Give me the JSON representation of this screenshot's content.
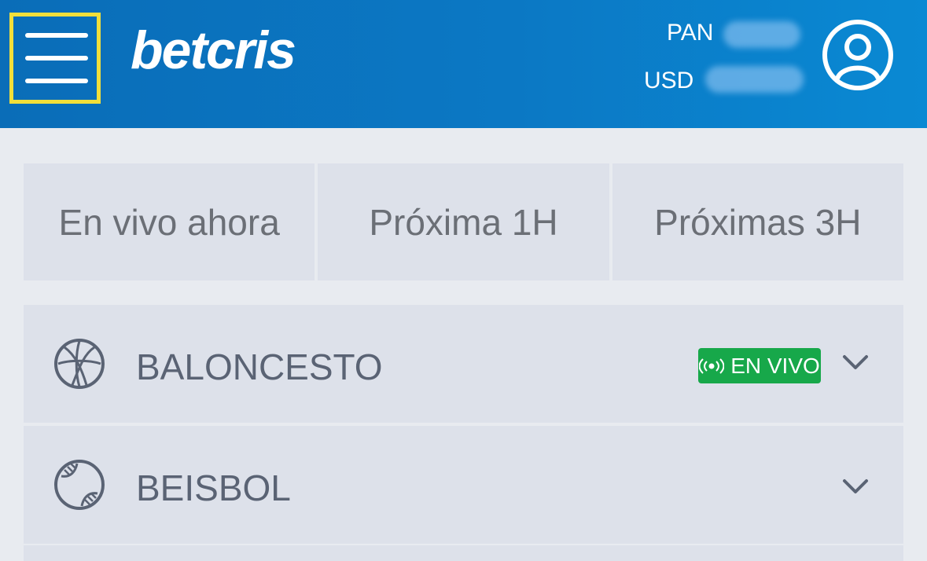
{
  "header": {
    "logo_text": "betcris",
    "balance_pan_label": "PAN",
    "balance_usd_label": "USD",
    "menu_icon": "hamburger-menu-icon",
    "profile_icon": "user-profile-icon",
    "colors": {
      "bar": "#0b78c4",
      "highlight": "#f2df3a"
    }
  },
  "tabs": [
    {
      "label": "En vivo ahora"
    },
    {
      "label": "Próxima 1H"
    },
    {
      "label": "Próximas 3H"
    }
  ],
  "sports": [
    {
      "label": "BALONCESTO",
      "icon": "basketball-icon",
      "live_badge": "EN VIVO"
    },
    {
      "label": "BEISBOL",
      "icon": "baseball-icon"
    }
  ],
  "badge_color": "#17a84a"
}
